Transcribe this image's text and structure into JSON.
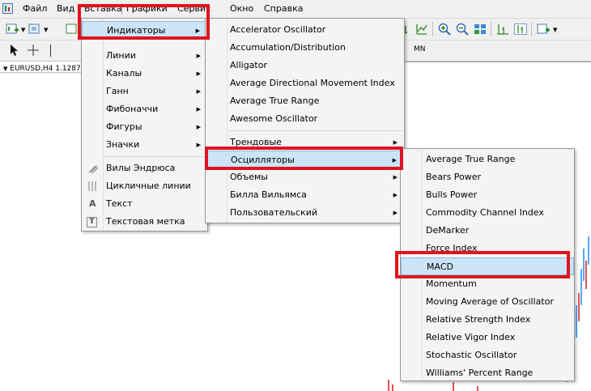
{
  "menubar": {
    "items": [
      "Файл",
      "Вид",
      "Вставка",
      "Графики",
      "Сервис",
      "Окно",
      "Справка"
    ]
  },
  "toolbar": {
    "timeframe_label": "MN"
  },
  "chart": {
    "tab_label": "EURUSD,H4  1.1287"
  },
  "insert_menu": {
    "items": [
      {
        "label": "Индикаторы",
        "arrow": "▶"
      },
      {
        "label": "Линии",
        "arrow": "▶"
      },
      {
        "label": "Каналы",
        "arrow": "▶"
      },
      {
        "label": "Ганн",
        "arrow": "▶"
      },
      {
        "label": "Фибоначчи",
        "arrow": "▶"
      },
      {
        "label": "Фигуры",
        "arrow": "▶"
      },
      {
        "label": "Значки",
        "arrow": "▶"
      },
      {
        "label": "Вилы Эндрюса",
        "arrow": ""
      },
      {
        "label": "Цикличные линии",
        "arrow": ""
      },
      {
        "label": "Текст",
        "arrow": ""
      },
      {
        "label": "Текстовая метка",
        "arrow": ""
      }
    ],
    "text_icon": "A",
    "text_label_icon": "T"
  },
  "indicators_menu": {
    "items": [
      {
        "label": "Accelerator Oscillator",
        "arrow": ""
      },
      {
        "label": "Accumulation/Distribution",
        "arrow": ""
      },
      {
        "label": "Alligator",
        "arrow": ""
      },
      {
        "label": "Average Directional Movement Index",
        "arrow": ""
      },
      {
        "label": "Average True Range",
        "arrow": ""
      },
      {
        "label": "Awesome Oscillator",
        "arrow": ""
      },
      {
        "label": "Трендовые",
        "arrow": "▶"
      },
      {
        "label": "Осцилляторы",
        "arrow": "▶"
      },
      {
        "label": "Объемы",
        "arrow": "▶"
      },
      {
        "label": "Билла Вильямса",
        "arrow": "▶"
      },
      {
        "label": "Пользовательский",
        "arrow": "▶"
      }
    ]
  },
  "oscillators_menu": {
    "items": [
      "Average True Range",
      "Bears Power",
      "Bulls Power",
      "Commodity Channel Index",
      "DeMarker",
      "Force Index",
      "MACD",
      "Momentum",
      "Moving Average of Oscillator",
      "Relative Strength Index",
      "Relative Vigor Index",
      "Stochastic Oscillator",
      "Williams' Percent Range"
    ]
  },
  "colors": {
    "highlight_box": "#e0141e",
    "menu_highlight": "#cce4f7",
    "candle_up": "#1e8cff",
    "candle_down": "#e0141e"
  }
}
